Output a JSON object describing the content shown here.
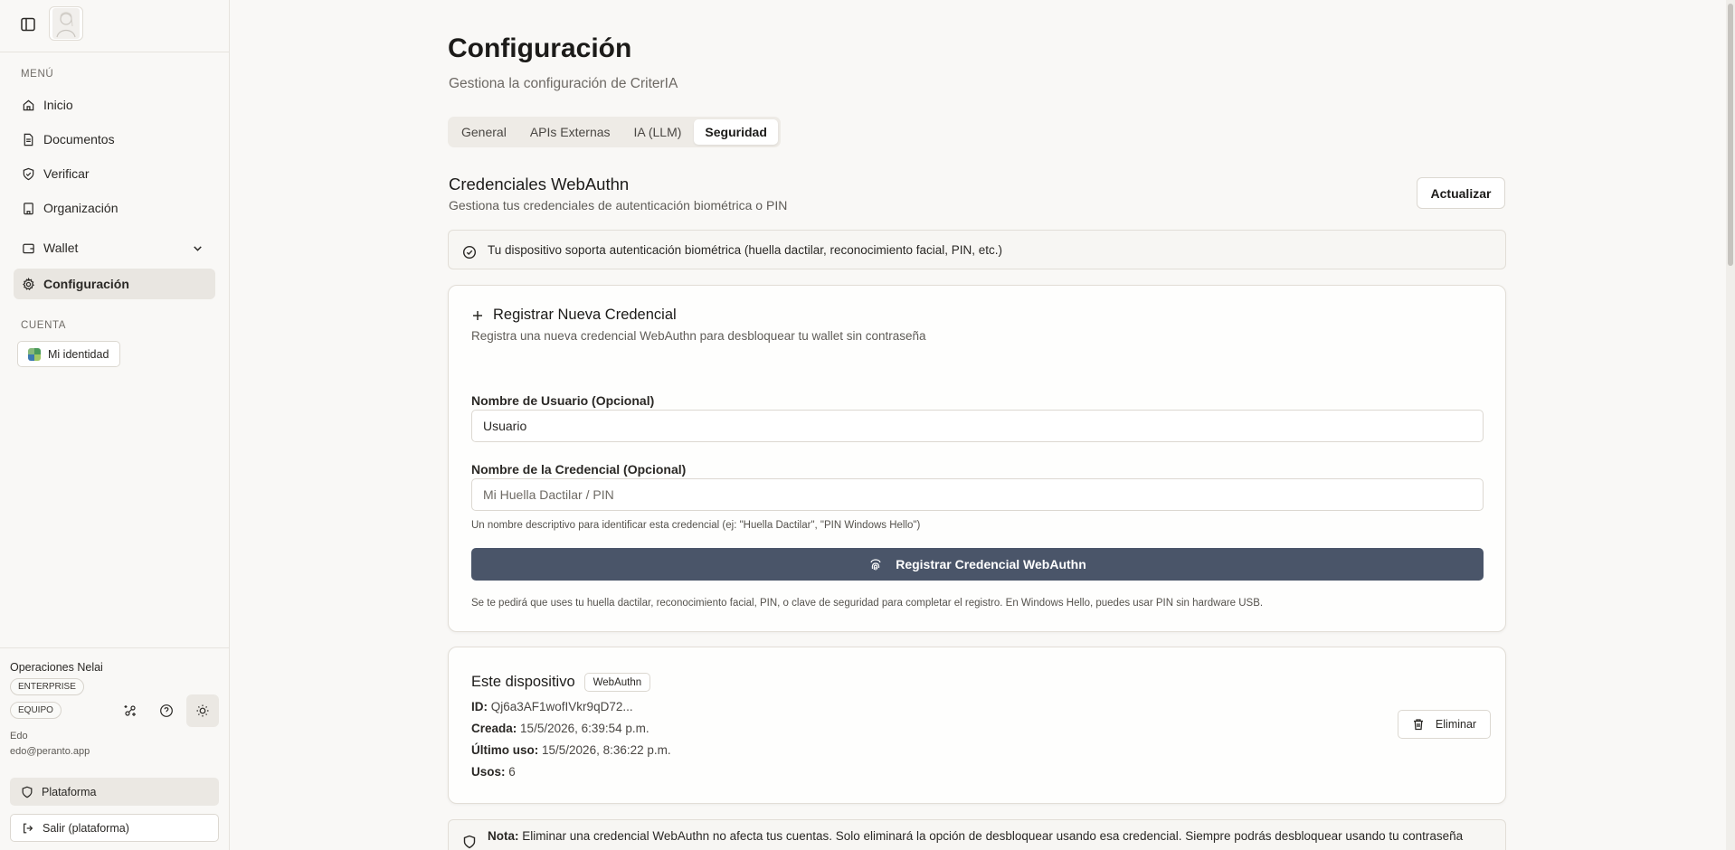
{
  "sidebar": {
    "menu_label": "MENÚ",
    "items": [
      {
        "label": "Inicio",
        "icon": "home-icon"
      },
      {
        "label": "Documentos",
        "icon": "document-icon"
      },
      {
        "label": "Verificar",
        "icon": "shield-check-icon"
      },
      {
        "label": "Organización",
        "icon": "building-icon"
      },
      {
        "label": "Wallet",
        "icon": "wallet-icon"
      },
      {
        "label": "Configuración",
        "icon": "gear-icon"
      }
    ],
    "account_label": "CUENTA",
    "identity_label": "Mi identidad",
    "org_name": "Operaciones Nelai",
    "plan_badge": "ENTERPRISE",
    "team_badge": "EQUIPO",
    "user_name": "Edo",
    "user_email": "edo@peranto.app",
    "platform_label": "Plataforma",
    "logout_label": "Salir (plataforma)"
  },
  "header": {
    "title": "Configuración",
    "subtitle": "Gestiona la configuración de CriterIA"
  },
  "tabs": [
    {
      "label": "General"
    },
    {
      "label": "APIs Externas"
    },
    {
      "label": "IA (LLM)"
    },
    {
      "label": "Seguridad"
    }
  ],
  "webauthn": {
    "title": "Credenciales WebAuthn",
    "subtitle": "Gestiona tus credenciales de autenticación biométrica o PIN",
    "refresh_label": "Actualizar",
    "support_message": "Tu dispositivo soporta autenticación biométrica (huella dactilar, reconocimiento facial, PIN, etc.)"
  },
  "register": {
    "title": "Registrar Nueva Credencial",
    "subtitle": "Registra una nueva credencial WebAuthn para desbloquear tu wallet sin contraseña",
    "username_label": "Nombre de Usuario (Opcional)",
    "username_value": "Usuario",
    "credential_label": "Nombre de la Credencial (Opcional)",
    "credential_placeholder": "Mi Huella Dactilar / PIN",
    "credential_help": "Un nombre descriptivo para identificar esta credencial (ej: \"Huella Dactilar\", \"PIN Windows Hello\")",
    "submit_label": "Registrar Credencial WebAuthn",
    "note": "Se te pedirá que uses tu huella dactilar, reconocimiento facial, PIN, o clave de seguridad para completar el registro. En Windows Hello, puedes usar PIN sin hardware USB."
  },
  "device": {
    "title": "Este dispositivo",
    "badge": "WebAuthn",
    "id_label": "ID:",
    "id_value": "Qj6a3AF1wofIVkr9qD72...",
    "created_label": "Creada:",
    "created_value": "15/5/2026, 6:39:54 p.m.",
    "last_used_label": "Último uso:",
    "last_used_value": "15/5/2026, 8:36:22 p.m.",
    "uses_label": "Usos:",
    "uses_value": "6",
    "delete_label": "Eliminar"
  },
  "footer_note": {
    "label": "Nota:",
    "text": "Eliminar una credencial WebAuthn no afecta tus cuentas. Solo eliminará la opción de desbloquear usando esa credencial. Siempre podrás desbloquear usando tu contraseña"
  },
  "colors": {
    "primary_button": "#4a5569",
    "background": "#f9f8f6",
    "active_nav": "#e9e6e1"
  }
}
